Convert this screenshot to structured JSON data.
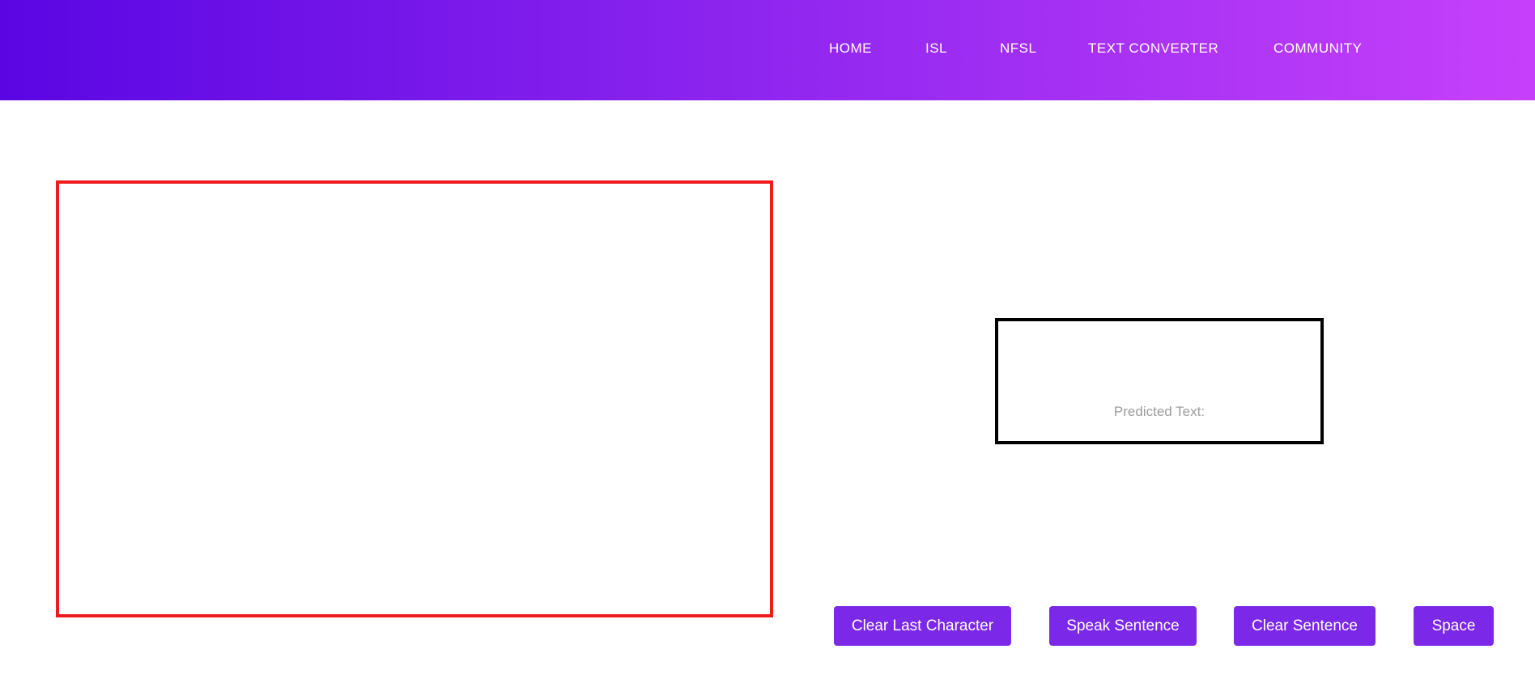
{
  "nav": {
    "items": [
      {
        "label": "HOME"
      },
      {
        "label": "ISL"
      },
      {
        "label": "NFSL"
      },
      {
        "label": "TEXT CONVERTER"
      },
      {
        "label": "COMMUNITY"
      }
    ]
  },
  "output": {
    "predicted_label": "Predicted Text:"
  },
  "actions": {
    "clear_last_character": "Clear Last Character",
    "speak_sentence": "Speak Sentence",
    "clear_sentence": "Clear Sentence",
    "space": "Space"
  },
  "colors": {
    "header_gradient_start": "#5a06e3",
    "header_gradient_end": "#c640fb",
    "button_bg": "#7b28e8",
    "video_border": "#ee1c1c"
  }
}
